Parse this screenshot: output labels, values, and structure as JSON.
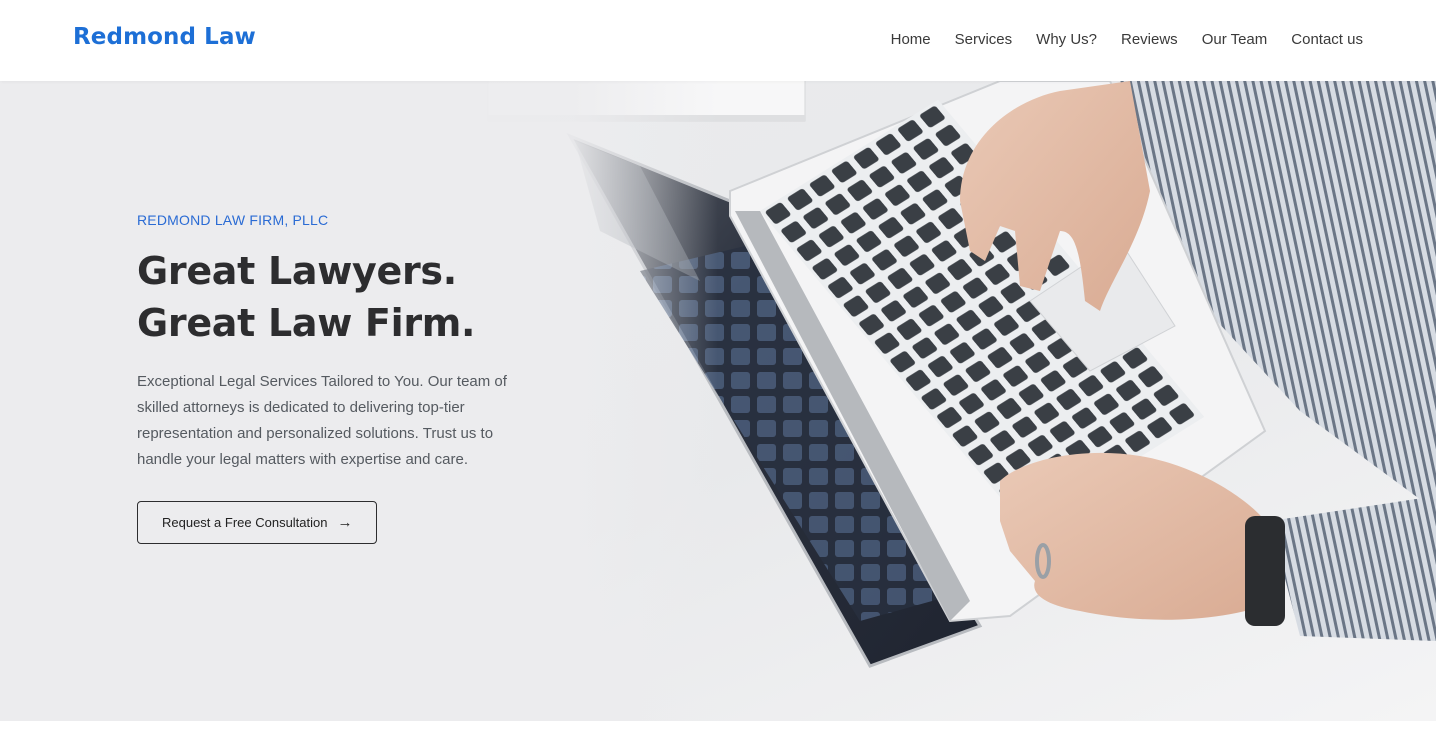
{
  "header": {
    "logo": "Redmond Law",
    "nav": [
      "Home",
      "Services",
      "Why Us?",
      "Reviews",
      "Our Team",
      "Contact us"
    ]
  },
  "hero": {
    "eyebrow": "REDMOND LAW FIRM, PLLC",
    "headline_line1": "Great Lawyers.",
    "headline_line2": "Great Law Firm.",
    "description": "Exceptional Legal Services Tailored to You. Our team of skilled attorneys is dedicated to delivering top-tier representation and personalized solutions. Trust us to handle your legal matters with expertise and care.",
    "cta_label": "Request a Free Consultation",
    "cta_icon": "arrow-right-icon",
    "image_subject": "laptop-typing-photo"
  },
  "colors": {
    "brand": "#1d6fd6",
    "eyebrow": "#2a6bd4",
    "heading": "#2d2d2f",
    "body_text": "#555a60",
    "hero_bg": "#ededef"
  }
}
